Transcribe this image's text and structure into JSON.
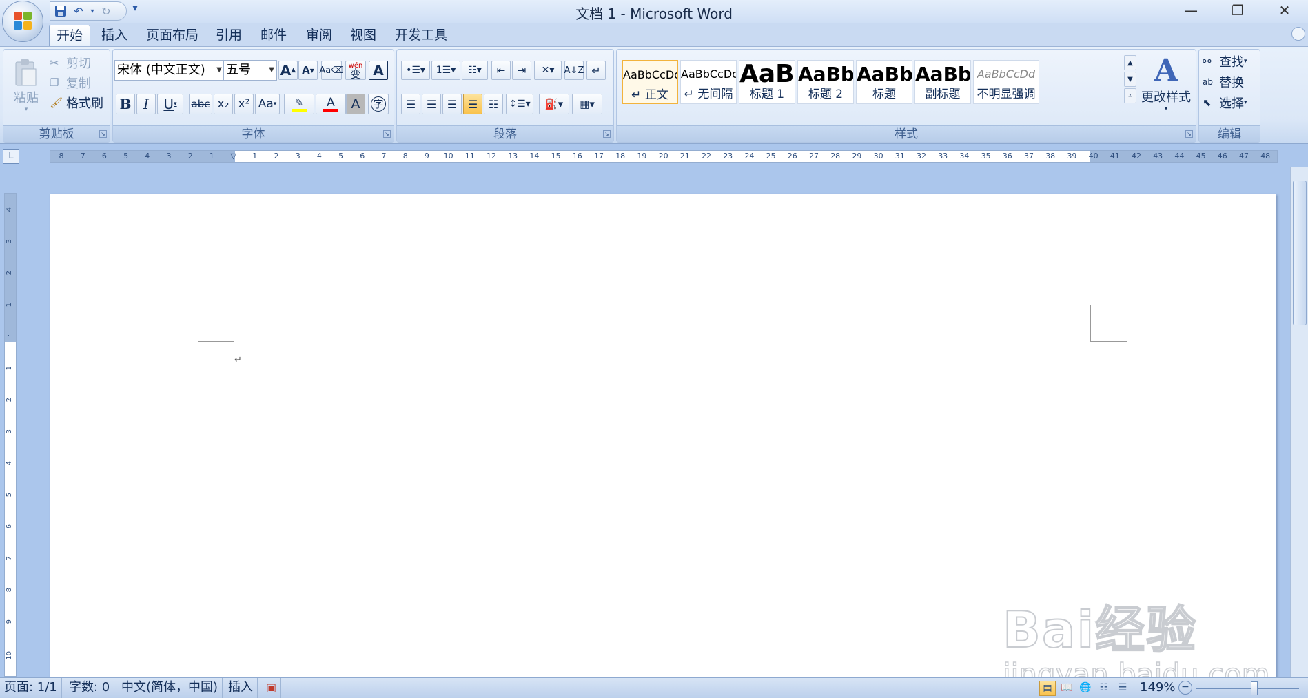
{
  "window": {
    "title": "文档 1 - Microsoft Word"
  },
  "qat": {
    "save": "save-icon",
    "undo": "undo-icon",
    "redo": "redo-icon",
    "more": "▾"
  },
  "tabs": [
    "开始",
    "插入",
    "页面布局",
    "引用",
    "邮件",
    "审阅",
    "视图",
    "开发工具"
  ],
  "clipboard": {
    "paste": "粘贴",
    "cut": "剪切",
    "copy": "复制",
    "format_painter": "格式刷",
    "label": "剪贴板"
  },
  "font": {
    "name": "宋体 (中文正文)",
    "size": "五号",
    "label": "字体",
    "bold": "B",
    "italic": "I",
    "underline": "U",
    "strike": "abc",
    "sub": "x₂",
    "sup": "x²",
    "case": "Aa",
    "grow": "A",
    "shrink": "A",
    "phonetic": "wén",
    "phonetic_char": "变",
    "border_char": "A",
    "shade_char": "A",
    "enclose_char": "字"
  },
  "paragraph": {
    "label": "段落",
    "active_align": "justify"
  },
  "styles": {
    "label": "样式",
    "items": [
      {
        "preview": "AaBbCcDdI",
        "name": "↵ 正文",
        "selected": true
      },
      {
        "preview": "AaBbCcDdI",
        "name": "↵ 无间隔",
        "selected": false
      },
      {
        "preview": "AaBb",
        "name": "标题 1",
        "selected": false
      },
      {
        "preview": "AaBbC",
        "name": "标题 2",
        "selected": false
      },
      {
        "preview": "AaBbC",
        "name": "标题",
        "selected": false
      },
      {
        "preview": "AaBbC",
        "name": "副标题",
        "selected": false
      },
      {
        "preview": "AaBbCcDd",
        "name": "不明显强调",
        "selected": false
      }
    ],
    "change": "更改样式"
  },
  "editing": {
    "find": "查找",
    "replace": "替换",
    "select": "选择",
    "label": "编辑"
  },
  "ruler": {
    "tab_selector": "L",
    "ticks": [
      "8",
      "7",
      "6",
      "5",
      "4",
      "3",
      "2",
      "1",
      "",
      "1",
      "2",
      "3",
      "4",
      "5",
      "6",
      "7",
      "8",
      "9",
      "10",
      "11",
      "12",
      "13",
      "14",
      "15",
      "16",
      "17",
      "18",
      "19",
      "20",
      "21",
      "22",
      "23",
      "24",
      "25",
      "26",
      "27",
      "28",
      "29",
      "30",
      "31",
      "32",
      "33",
      "34",
      "35",
      "36",
      "37",
      "38",
      "39",
      "40",
      "41",
      "42",
      "43",
      "44",
      "45",
      "46",
      "47",
      "48"
    ],
    "vticks": [
      "4",
      "3",
      "2",
      "1",
      "",
      "1",
      "2",
      "3",
      "4",
      "5",
      "6",
      "7",
      "8",
      "9",
      "10"
    ]
  },
  "document": {
    "paragraph_mark": "↵"
  },
  "status": {
    "page": "页面: 1/1",
    "words": "字数: 0",
    "language": "中文(简体，中国)",
    "mode": "插入",
    "zoom": "149%"
  },
  "watermark": {
    "brand": "Bai经验",
    "url": "jingyan.baidu.com"
  },
  "colors": {
    "highlight": "#ffff00",
    "font_color": "#ff0000",
    "accent": "#f2b33d"
  }
}
